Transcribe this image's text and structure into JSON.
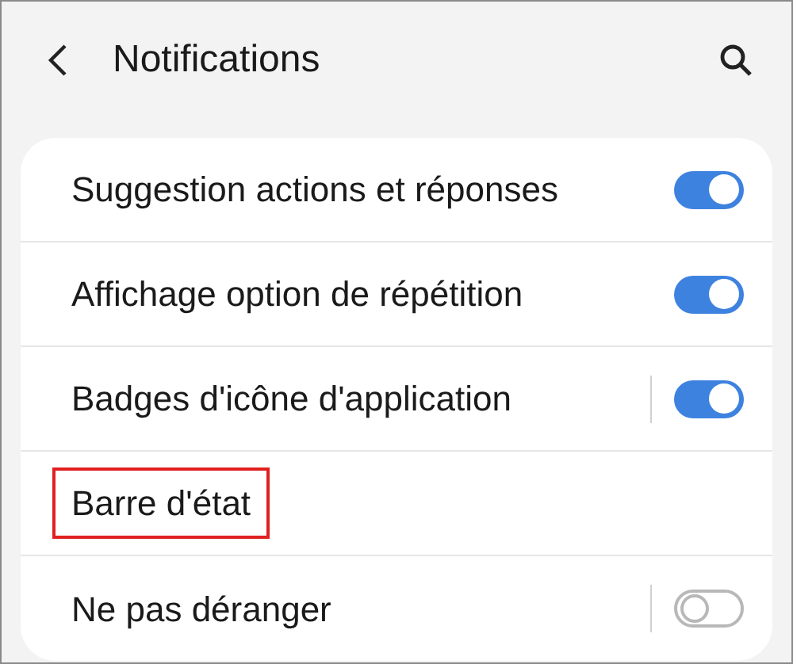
{
  "header": {
    "title": "Notifications"
  },
  "rows": [
    {
      "kind": "toggle",
      "label": "Suggestion actions et réponses",
      "on": true,
      "divider": false,
      "highlighted": false
    },
    {
      "kind": "toggle",
      "label": "Affichage option de répétition",
      "on": true,
      "divider": false,
      "highlighted": false
    },
    {
      "kind": "toggle",
      "label": "Badges d'icône d'application",
      "on": true,
      "divider": true,
      "highlighted": false
    },
    {
      "kind": "link",
      "label": "Barre d'état",
      "divider": false,
      "highlighted": true
    },
    {
      "kind": "toggle",
      "label": "Ne pas déranger",
      "on": false,
      "divider": true,
      "highlighted": false
    }
  ]
}
